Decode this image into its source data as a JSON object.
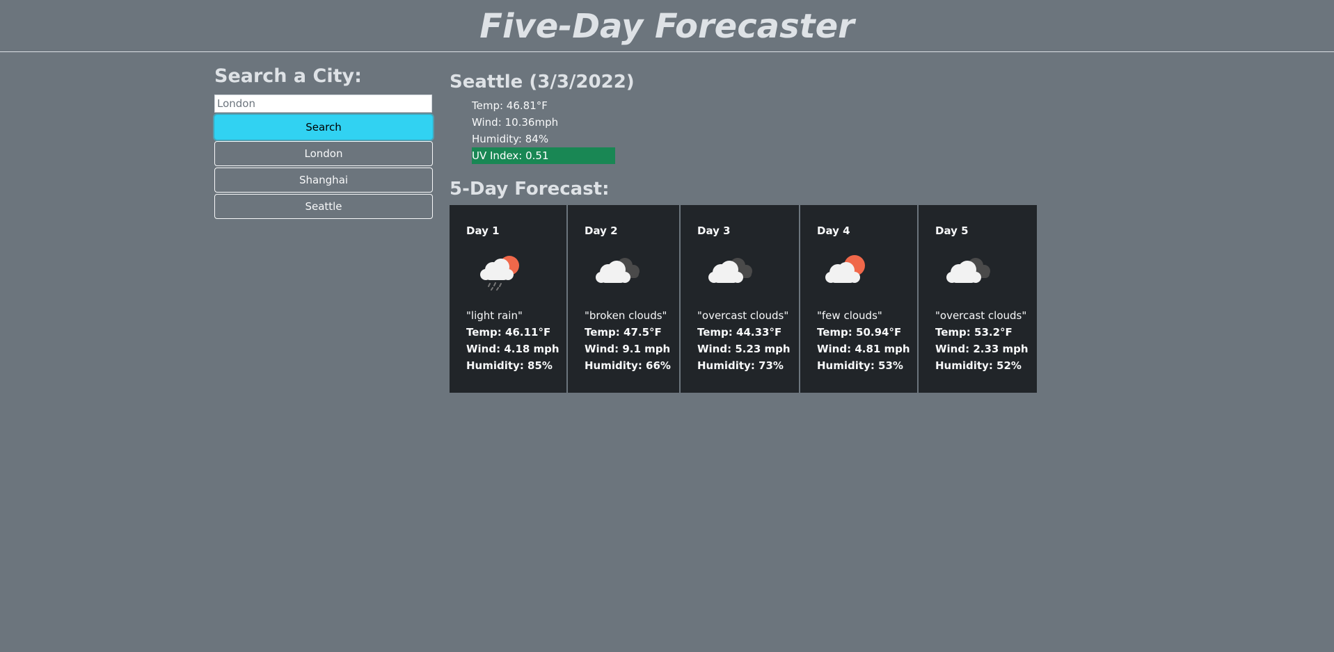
{
  "header": {
    "title": "Five-Day Forecaster"
  },
  "search": {
    "heading": "Search a City:",
    "input_placeholder": "London",
    "search_label": "Search",
    "history": [
      "London",
      "Shanghai",
      "Seattle"
    ]
  },
  "current": {
    "city_date": "Seattle (3/3/2022)",
    "temp": "Temp: 46.81°F",
    "wind": "Wind: 10.36mph",
    "humidity": "Humidity: 84%",
    "uv": "UV Index: 0.51",
    "uv_color": "#198754"
  },
  "forecast": {
    "title": "5-Day Forecast:",
    "days": [
      {
        "day": "Day 1",
        "icon": "light-rain-icon",
        "desc": "\"light rain\"",
        "temp": "Temp: 46.11°F",
        "wind": "Wind: 4.18 mph",
        "humidity": "Humidity: 85%"
      },
      {
        "day": "Day 2",
        "icon": "broken-clouds-icon",
        "desc": "\"broken clouds\"",
        "temp": "Temp: 47.5°F",
        "wind": "Wind: 9.1 mph",
        "humidity": "Humidity: 66%"
      },
      {
        "day": "Day 3",
        "icon": "overcast-clouds-icon",
        "desc": "\"overcast clouds\"",
        "temp": "Temp: 44.33°F",
        "wind": "Wind: 5.23 mph",
        "humidity": "Humidity: 73%"
      },
      {
        "day": "Day 4",
        "icon": "few-clouds-icon",
        "desc": "\"few clouds\"",
        "temp": "Temp: 50.94°F",
        "wind": "Wind: 4.81 mph",
        "humidity": "Humidity: 53%"
      },
      {
        "day": "Day 5",
        "icon": "overcast-clouds-icon",
        "desc": "\"overcast clouds\"",
        "temp": "Temp: 53.2°F",
        "wind": "Wind: 2.33 mph",
        "humidity": "Humidity: 52%"
      }
    ]
  },
  "colors": {
    "background": "#6c757d",
    "card": "#212529",
    "search_button": "#31d2f2",
    "uv_badge": "#198754",
    "sun": "#f0684a"
  }
}
